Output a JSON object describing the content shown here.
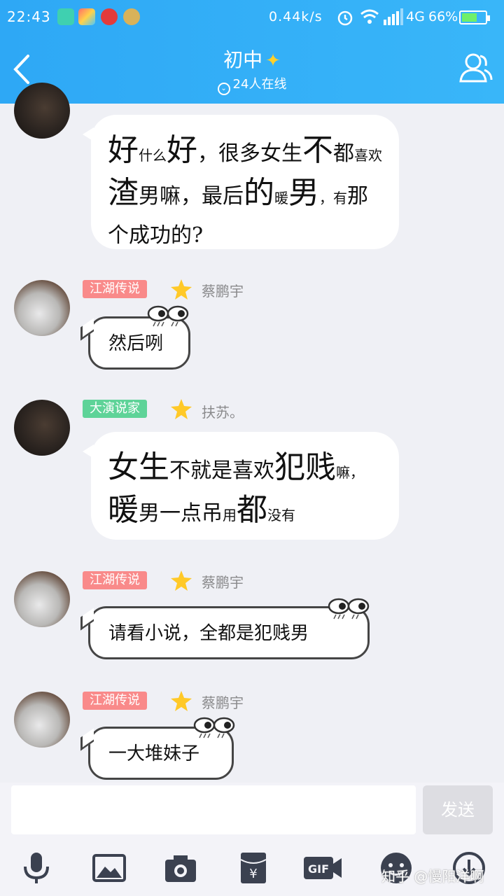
{
  "status_bar": {
    "time": "22:43",
    "network_speed": "0.44k/s",
    "network_type": "4G",
    "battery_percent": "66%",
    "battery_level": 0.66
  },
  "header": {
    "title": "初中",
    "online_count": "24人在线"
  },
  "messages": [
    {
      "segments": [
        {
          "t": "好",
          "s": "lg"
        },
        {
          "t": "什么",
          "s": "sm"
        },
        {
          "t": "好",
          "s": "lg"
        },
        {
          "t": "，很多女生",
          "s": "md"
        },
        {
          "t": "不",
          "s": "lg"
        },
        {
          "t": "都",
          "s": "md"
        },
        {
          "t": "喜欢",
          "s": "sm"
        },
        {
          "t": "渣",
          "s": "lg"
        },
        {
          "t": "男嘛，最后",
          "s": "md"
        },
        {
          "t": "的",
          "s": "lg"
        },
        {
          "t": "暖",
          "s": "sm"
        },
        {
          "t": "男",
          "s": "lg"
        },
        {
          "t": "，有",
          "s": "sm"
        },
        {
          "t": "那个成功的?",
          "s": "md"
        }
      ]
    },
    {
      "badge": "江湖传说",
      "nickname": "蔡鹏宇",
      "text": "然后咧"
    },
    {
      "badge": "大演说家",
      "nickname": "扶苏。",
      "segments": [
        {
          "t": "女生",
          "s": "lg"
        },
        {
          "t": "不就是喜欢",
          "s": "md"
        },
        {
          "t": "犯贱",
          "s": "lg"
        },
        {
          "t": "嘛，",
          "s": "sm"
        },
        {
          "t": "暖",
          "s": "lg"
        },
        {
          "t": "男一点吊",
          "s": "md"
        },
        {
          "t": "用",
          "s": "sm"
        },
        {
          "t": "都",
          "s": "lg"
        },
        {
          "t": "没有",
          "s": "sm"
        }
      ]
    },
    {
      "badge": "江湖传说",
      "nickname": "蔡鹏宇",
      "text": "请看小说，全都是犯贱男"
    },
    {
      "badge": "江湖传说",
      "nickname": "蔡鹏宇",
      "text": "一大堆妹子"
    }
  ],
  "input_bar": {
    "placeholder": "",
    "send_label": "发送"
  },
  "toolbar_icons": [
    "microphone-icon",
    "image-icon",
    "camera-icon",
    "red-packet-icon",
    "gif-icon",
    "emoji-icon",
    "more-icon"
  ],
  "watermark": "知乎 @慢阳洋啊"
}
